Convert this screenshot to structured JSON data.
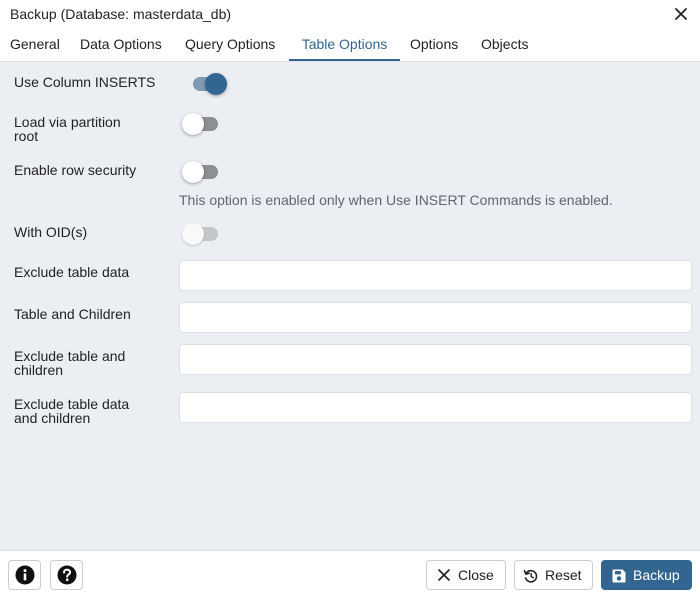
{
  "dialog": {
    "title": "Backup (Database: masterdata_db)"
  },
  "tabs": [
    {
      "label": "General",
      "active": false
    },
    {
      "label": "Data Options",
      "active": false
    },
    {
      "label": "Query Options",
      "active": false
    },
    {
      "label": "Table Options",
      "active": true
    },
    {
      "label": "Options",
      "active": false
    },
    {
      "label": "Objects",
      "active": false
    }
  ],
  "form": {
    "use_column_inserts": {
      "label": "Use Column INSERTS",
      "value": true
    },
    "load_via_partition_root": {
      "label_line1": "Load via partition",
      "label_line2": "root",
      "value": false
    },
    "enable_row_security": {
      "label": "Enable row security",
      "value": false,
      "hint": "This option is enabled only when Use INSERT Commands is enabled."
    },
    "with_oids": {
      "label": "With OID(s)",
      "value": false,
      "disabled": true
    },
    "exclude_table_data": {
      "label": "Exclude table data",
      "value": ""
    },
    "table_and_children": {
      "label": "Table and Children",
      "value": ""
    },
    "exclude_table_and_children": {
      "label_line1": "Exclude table and",
      "label_line2": "children",
      "value": ""
    },
    "exclude_table_data_and_children": {
      "label_line1": "Exclude table data",
      "label_line2": "and children",
      "value": ""
    }
  },
  "footer": {
    "info_icon": "info-icon",
    "help_icon": "help-icon",
    "close_label": "Close",
    "reset_label": "Reset",
    "backup_label": "Backup"
  },
  "colors": {
    "accent": "#326690",
    "panel_background": "#ebeef3",
    "hint_text": "#61656e"
  }
}
